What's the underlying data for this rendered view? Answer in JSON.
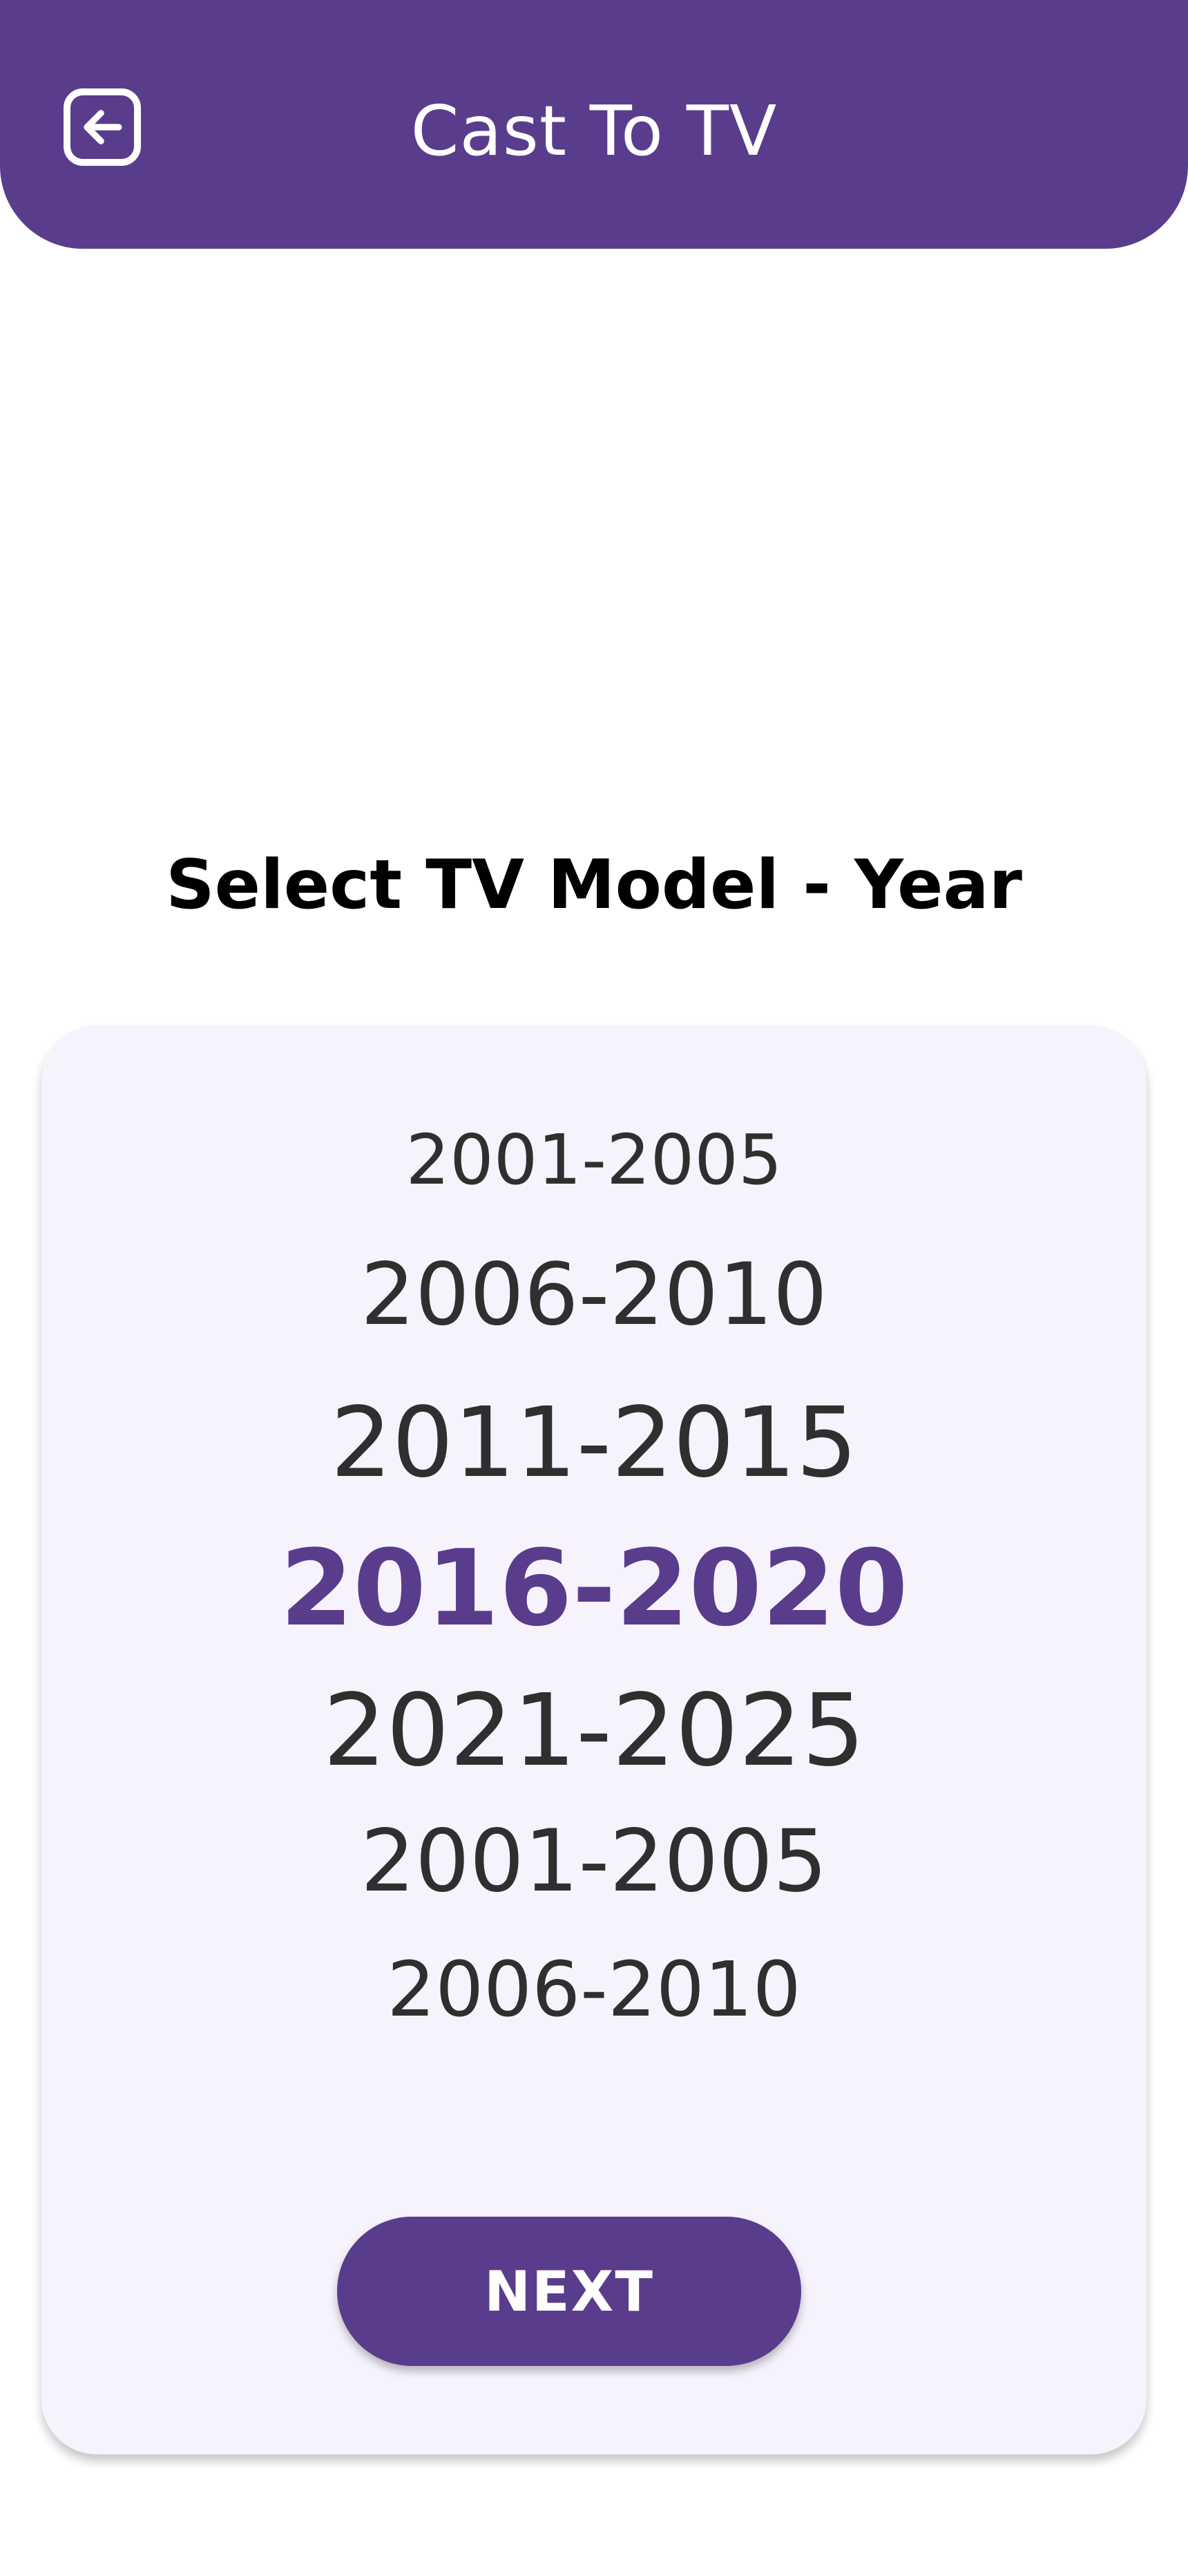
{
  "header": {
    "title": "Cast To TV",
    "back_icon": "back-arrow-icon"
  },
  "main": {
    "title": "Select TV Model - Year",
    "picker": {
      "items": [
        "2001-2005",
        "2006-2010",
        "2011-2015",
        "2016-2020",
        "2021-2025",
        "2001-2005",
        "2006-2010"
      ],
      "selected": "2016-2020"
    },
    "next_label": "NEXT"
  },
  "colors": {
    "primary": "#5a3c8c",
    "card_background": "#f6f3fc",
    "text": "#2f2f2f"
  }
}
